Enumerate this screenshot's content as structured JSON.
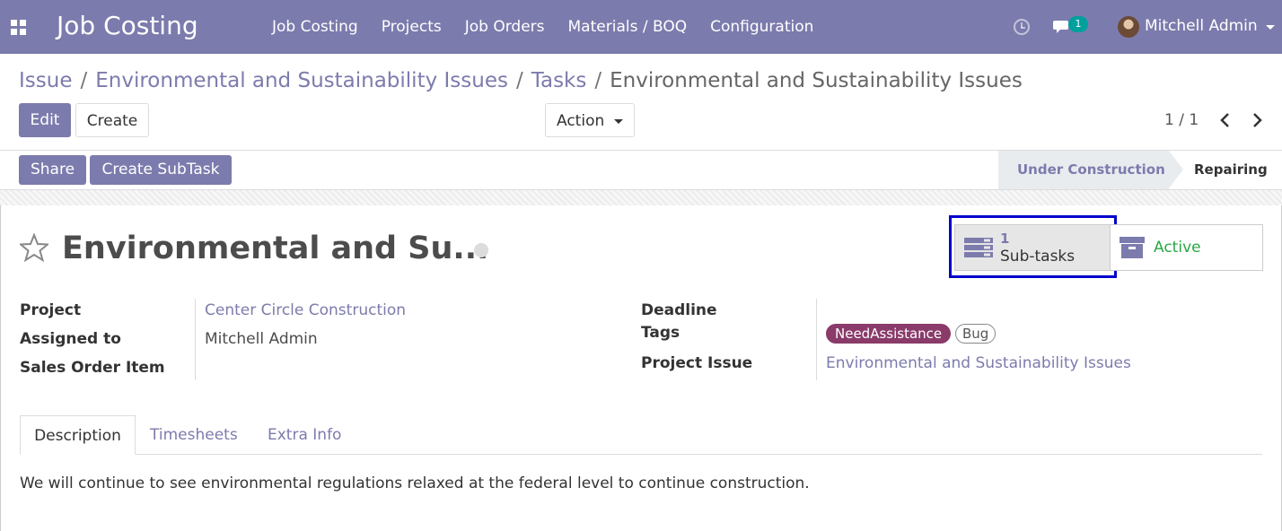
{
  "navbar": {
    "brand": "Job Costing",
    "menu": [
      "Job Costing",
      "Projects",
      "Job Orders",
      "Materials / BOQ",
      "Configuration"
    ],
    "chat_count": "1",
    "user": "Mitchell Admin"
  },
  "breadcrumb": {
    "items": [
      "Issue",
      "Environmental and Sustainability Issues",
      "Tasks"
    ],
    "separator": "/",
    "current": "Environmental and Sustainability Issues"
  },
  "toolbar": {
    "edit": "Edit",
    "create": "Create",
    "action": "Action",
    "pager": "1 / 1"
  },
  "statusbar": {
    "share": "Share",
    "create_subtask": "Create SubTask",
    "stages": [
      "Under Construction",
      "Repairing"
    ],
    "current_stage": "Repairing"
  },
  "record": {
    "title": "Environmental and Su...",
    "subtasks_count": "1",
    "subtasks_label": "Sub-tasks",
    "active_label": "Active",
    "fields_left": [
      {
        "label": "Project",
        "value": "Center Circle Construction"
      },
      {
        "label": "Assigned to",
        "value": "Mitchell Admin"
      },
      {
        "label": "Sales Order Item",
        "value": ""
      }
    ],
    "fields_right": [
      {
        "label": "Deadline",
        "value": ""
      },
      {
        "label": "Tags",
        "tags": [
          "NeedAssistance",
          "Bug"
        ]
      },
      {
        "label": "Project Issue",
        "value": "Environmental and Sustainability Issues"
      }
    ]
  },
  "tabs": [
    "Description",
    "Timesheets",
    "Extra Info"
  ],
  "active_tab": "Description",
  "description": "We will continue to see environmental regulations relaxed at the federal level to continue construction.",
  "colors": {
    "brand": "#7c7bad",
    "highlight_box": "#0000cc",
    "active_green": "#28a745",
    "tag_need": "#8a3b6a",
    "chat_badge": "#00a09d"
  }
}
